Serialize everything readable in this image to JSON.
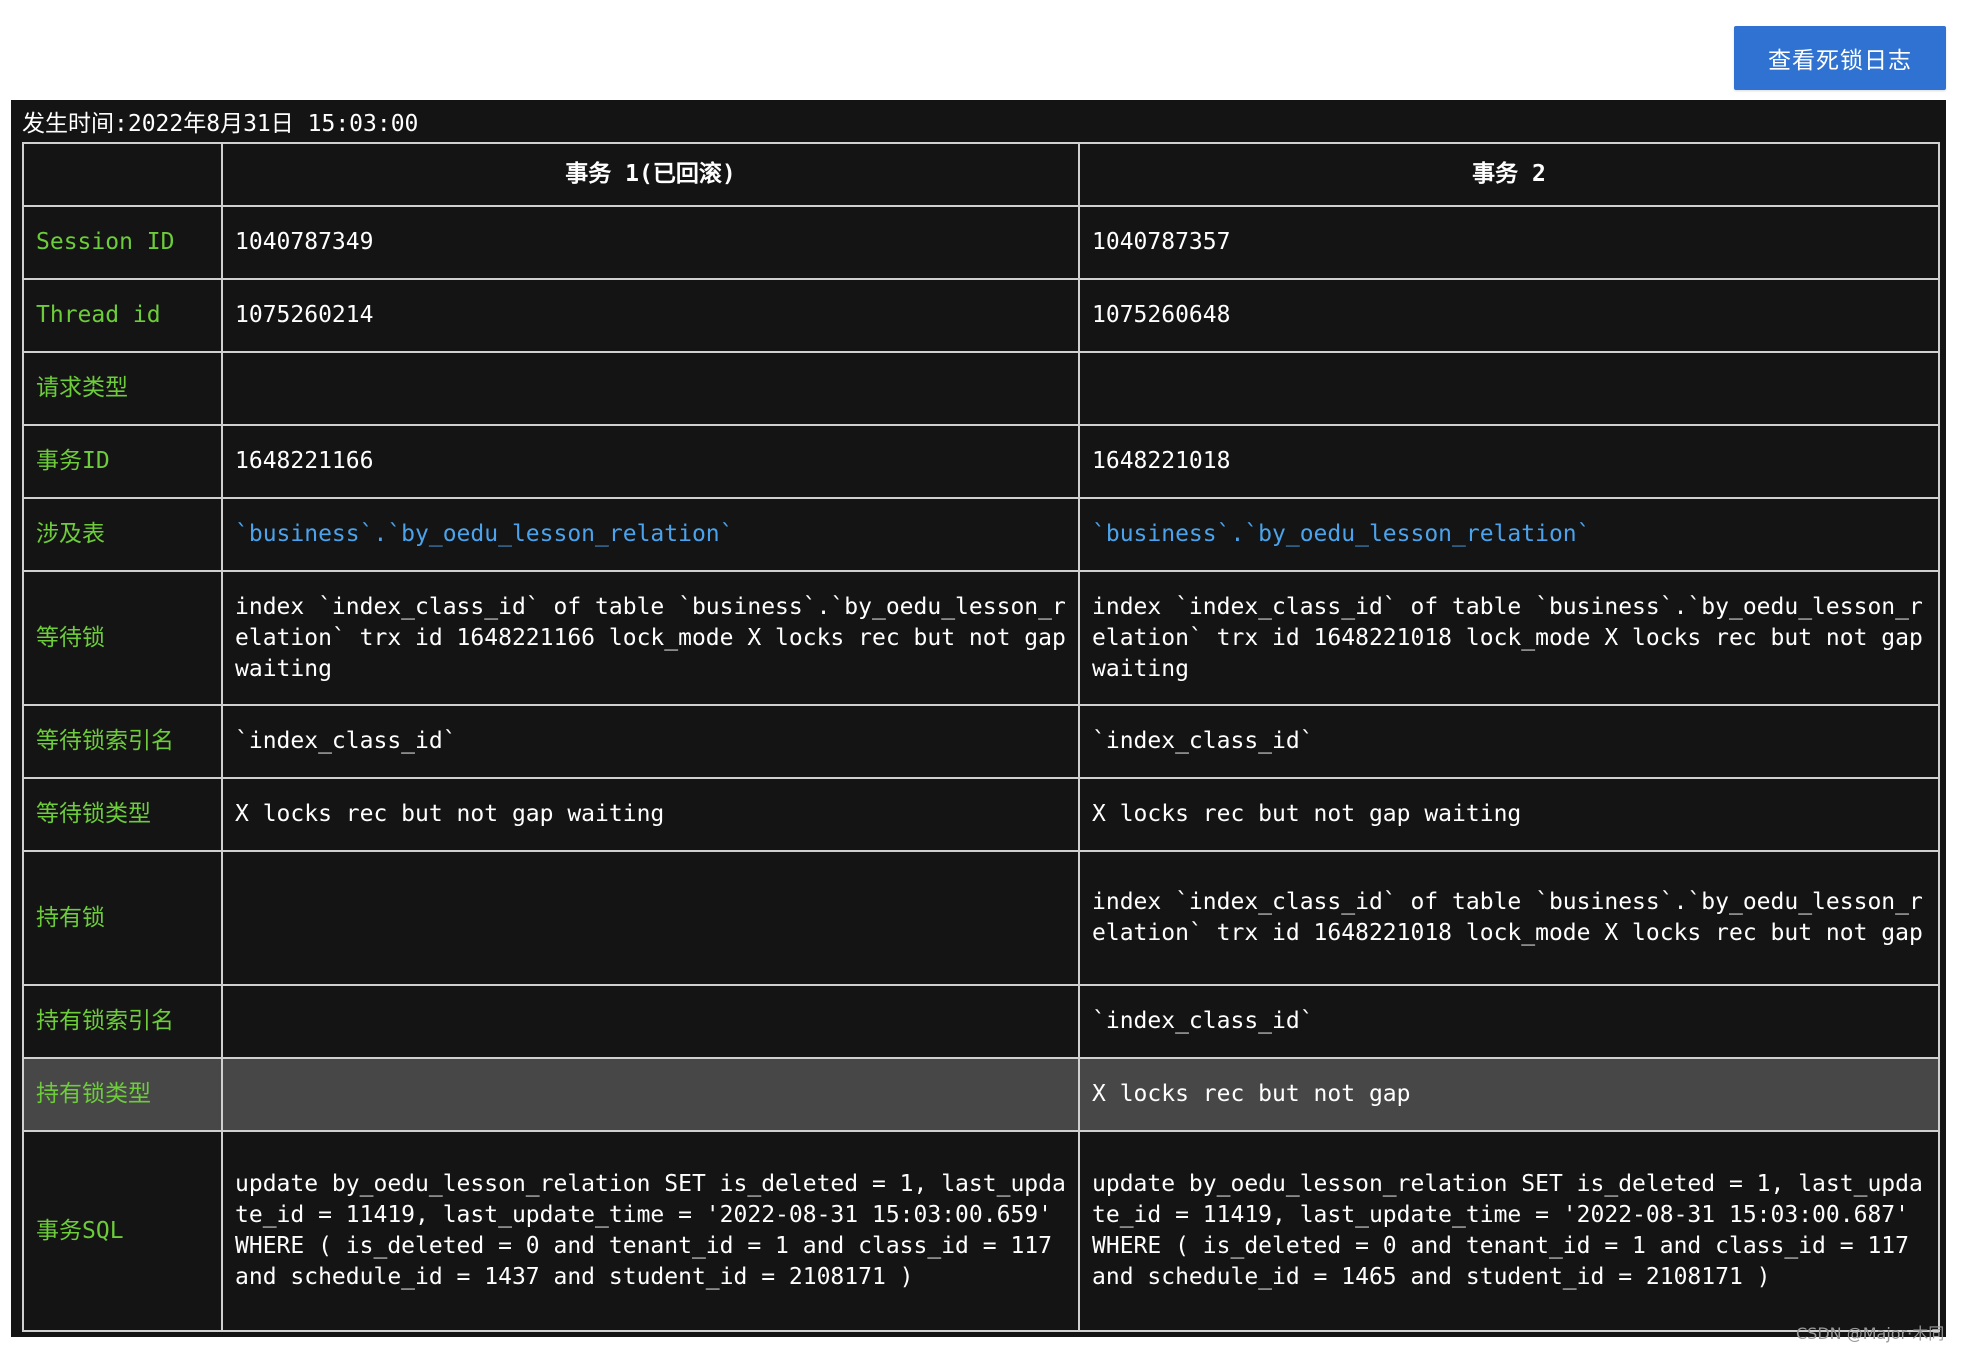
{
  "toolbar": {
    "view_log_label": "查看死锁日志"
  },
  "deadlock": {
    "occur_time": "发生时间:2022年8月31日 15:03:00",
    "headers": [
      "",
      "事务 1(已回滚)",
      "事务 2"
    ],
    "rows": [
      {
        "label": "Session ID",
        "t1": "1040787349",
        "t2": "1040787357"
      },
      {
        "label": "Thread id",
        "t1": "1075260214",
        "t2": "1075260648"
      },
      {
        "label": "请求类型",
        "t1": "",
        "t2": ""
      },
      {
        "label": "事务ID",
        "t1": "1648221166",
        "t2": "1648221018"
      },
      {
        "label": "涉及表",
        "t1": "`business`.`by_oedu_lesson_relation`",
        "t2": "`business`.`by_oedu_lesson_relation`"
      },
      {
        "label": "等待锁",
        "t1": "index `index_class_id` of table `business`.`by_oedu_lesson_relation` trx id 1648221166 lock_mode X locks rec but not gap waiting",
        "t2": "index `index_class_id` of table `business`.`by_oedu_lesson_relation` trx id 1648221018 lock_mode X locks rec but not gap waiting"
      },
      {
        "label": "等待锁索引名",
        "t1": "`index_class_id`",
        "t2": "`index_class_id`"
      },
      {
        "label": "等待锁类型",
        "t1": "X locks rec but not gap waiting",
        "t2": "X locks rec but not gap waiting"
      },
      {
        "label": "持有锁",
        "t1": "",
        "t2": "index `index_class_id` of table `business`.`by_oedu_lesson_relation` trx id 1648221018 lock_mode X locks rec but not gap"
      },
      {
        "label": "持有锁索引名",
        "t1": "",
        "t2": "`index_class_id`"
      },
      {
        "label": "持有锁类型",
        "t1": "",
        "t2": "X locks rec but not gap"
      },
      {
        "label": "事务SQL",
        "t1": "update by_oedu_lesson_relation SET is_deleted = 1, last_update_id = 11419, last_update_time = '2022-08-31 15:03:00.659' WHERE ( is_deleted = 0 and tenant_id = 1 and class_id = 117 and schedule_id = 1437 and student_id = 2108171 )",
        "t2": "update by_oedu_lesson_relation SET is_deleted = 1, last_update_id = 11419, last_update_time = '2022-08-31 15:03:00.687' WHERE ( is_deleted = 0 and tenant_id = 1 and class_id = 117 and schedule_id = 1465 and student_id = 2108171 )"
      }
    ]
  },
  "watermark": "CSDN @Major·木同",
  "colors": {
    "accent": "#2f72d1",
    "label": "#6ccc3a",
    "table_name": "#4aa3ec",
    "panel_bg": "#141414",
    "highlight_row": "#474747"
  }
}
